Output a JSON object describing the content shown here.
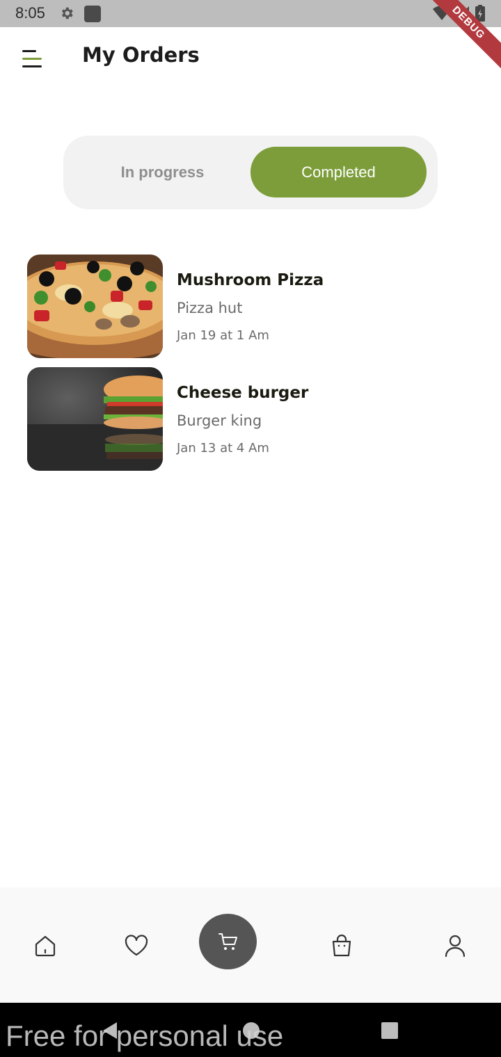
{
  "status_bar": {
    "time": "8:05",
    "debug_label": "DEBUG",
    "icons": [
      "gear-icon",
      "notification-square-icon",
      "wifi-icon",
      "signal-icon",
      "battery-icon"
    ]
  },
  "header": {
    "title": "My Orders",
    "menu_icon": "menu-icon",
    "accent_color": "#7c9d3a"
  },
  "tabs": {
    "in_progress": "In progress",
    "completed": "Completed",
    "selected": "Completed"
  },
  "orders": [
    {
      "name": "Mushroom Pizza",
      "store": "Pizza hut",
      "date": "Jan 19 at 1 Am",
      "image": "pizza-photo"
    },
    {
      "name": "Cheese burger",
      "store": "Burger king",
      "date": "Jan 13 at 4 Am",
      "image": "burger-photo"
    }
  ],
  "bottom_nav": {
    "items": [
      "home-icon",
      "heart-icon",
      "cart-icon",
      "bag-icon",
      "profile-icon"
    ],
    "active": "cart-icon"
  },
  "watermark": "Free for personal use",
  "colors": {
    "accent": "#7c9d3a",
    "cart_button": "#555555",
    "segment_bg": "#f2f2f2"
  }
}
